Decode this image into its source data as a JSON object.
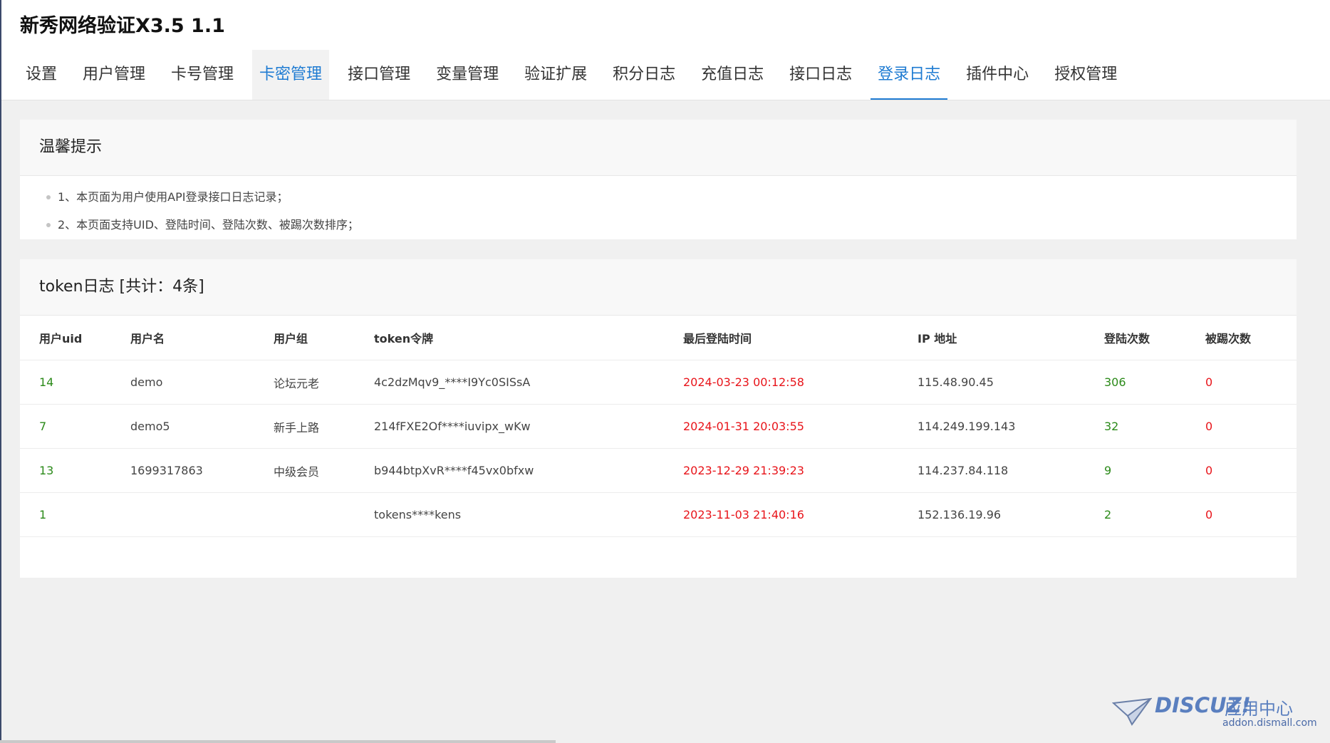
{
  "app": {
    "title": "新秀网络验证X3.5 1.1"
  },
  "nav": {
    "tabs": [
      {
        "label": "设置",
        "state": "normal"
      },
      {
        "label": "用户管理",
        "state": "normal"
      },
      {
        "label": "卡号管理",
        "state": "normal"
      },
      {
        "label": "卡密管理",
        "state": "hover"
      },
      {
        "label": "接口管理",
        "state": "normal"
      },
      {
        "label": "变量管理",
        "state": "normal"
      },
      {
        "label": "验证扩展",
        "state": "normal"
      },
      {
        "label": "积分日志",
        "state": "normal"
      },
      {
        "label": "充值日志",
        "state": "normal"
      },
      {
        "label": "接口日志",
        "state": "normal"
      },
      {
        "label": "登录日志",
        "state": "active"
      },
      {
        "label": "插件中心",
        "state": "normal"
      },
      {
        "label": "授权管理",
        "state": "normal"
      }
    ]
  },
  "tips": {
    "title": "温馨提示",
    "items": [
      "1、本页面为用户使用API登录接口日志记录；",
      "2、本页面支持UID、登陆时间、登陆次数、被踢次数排序；"
    ]
  },
  "log": {
    "title": "token日志 [共计：4条]",
    "columns": [
      "用户uid",
      "用户名",
      "用户组",
      "token令牌",
      "最后登陆时间",
      "IP 地址",
      "登陆次数",
      "被踢次数"
    ],
    "rows": [
      {
        "uid": "14",
        "username": "demo",
        "group": "论坛元老",
        "token": "4c2dzMqv9_****I9Yc0SISsA",
        "last_login": "2024-03-23 00:12:58",
        "ip": "115.48.90.45",
        "login_count": "306",
        "kick_count": "0"
      },
      {
        "uid": "7",
        "username": "demo5",
        "group": "新手上路",
        "token": "214fFXE2Of****iuvipx_wKw",
        "last_login": "2024-01-31 20:03:55",
        "ip": "114.249.199.143",
        "login_count": "32",
        "kick_count": "0"
      },
      {
        "uid": "13",
        "username": "1699317863",
        "group": "中级会员",
        "token": "b944btpXvR****f45vx0bfxw",
        "last_login": "2023-12-29 21:39:23",
        "ip": "114.237.84.118",
        "login_count": "9",
        "kick_count": "0"
      },
      {
        "uid": "1",
        "username": "",
        "group": "",
        "token": "tokens****kens",
        "last_login": "2023-11-03 21:40:16",
        "ip": "152.136.19.96",
        "login_count": "2",
        "kick_count": "0"
      }
    ]
  },
  "watermark": {
    "brand": "DISCUZ!",
    "subtitle": "应用中心",
    "url": "addon.dismall.com",
    "icon": "paper-plane-icon"
  },
  "colors": {
    "accent": "#1e7bd2",
    "uid_green": "#2b8a19",
    "time_red": "#e8141a",
    "count_green": "#2b8a19",
    "kick_red": "#e8141a"
  }
}
